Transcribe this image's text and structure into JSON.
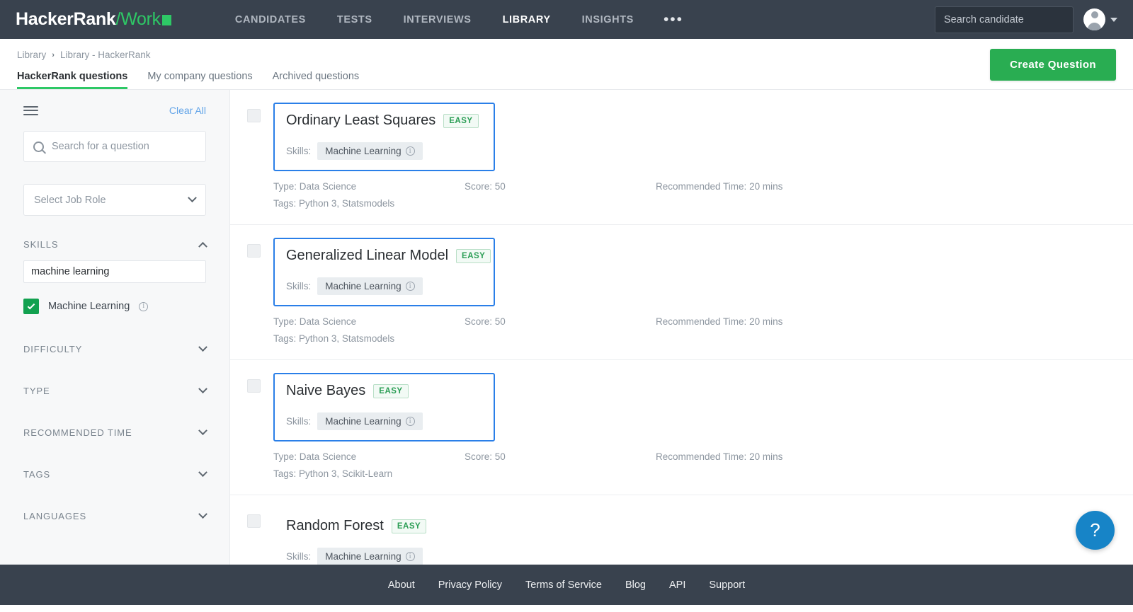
{
  "topnav": {
    "brand_main": "HackerRank",
    "brand_work": "/Work",
    "links": [
      {
        "label": "CANDIDATES",
        "active": false
      },
      {
        "label": "TESTS",
        "active": false
      },
      {
        "label": "INTERVIEWS",
        "active": false
      },
      {
        "label": "LIBRARY",
        "active": true
      },
      {
        "label": "INSIGHTS",
        "active": false
      }
    ],
    "more_dots": "•••",
    "search_placeholder": "Search candidate",
    "search_value": ""
  },
  "subheader": {
    "breadcrumb": [
      "Library",
      "Library - HackerRank"
    ],
    "breadcrumb_sep": "›",
    "tabs": [
      {
        "label": "HackerRank questions",
        "active": true
      },
      {
        "label": "My company questions",
        "active": false
      },
      {
        "label": "Archived questions",
        "active": false
      }
    ],
    "create_button": "Create Question"
  },
  "sidebar": {
    "clear_all": "Clear All",
    "search_placeholder": "Search for a question",
    "search_value": "",
    "job_role_label": "Select Job Role",
    "skills_section": {
      "title": "SKILLS",
      "input_value": "machine learning",
      "options": [
        {
          "label": "Machine Learning",
          "checked": true
        }
      ]
    },
    "collapsed_sections": [
      {
        "title": "DIFFICULTY"
      },
      {
        "title": "TYPE"
      },
      {
        "title": "RECOMMENDED TIME"
      },
      {
        "title": "TAGS"
      },
      {
        "title": "LANGUAGES"
      }
    ]
  },
  "questions": {
    "labels": {
      "skills": "Skills:",
      "type": "Type:",
      "score": "Score:",
      "tags": "Tags:",
      "recommended_time": "Recommended Time:"
    },
    "items": [
      {
        "title": "Ordinary Least Squares",
        "difficulty": "EASY",
        "skill": "Machine Learning",
        "type": "Data Science",
        "score": "50",
        "tags": "Python 3, Statsmodels",
        "time": "20 mins",
        "highlighted": true,
        "selected": false
      },
      {
        "title": "Generalized Linear Model",
        "difficulty": "EASY",
        "skill": "Machine Learning",
        "type": "Data Science",
        "score": "50",
        "tags": "Python 3, Statsmodels",
        "time": "20 mins",
        "highlighted": true,
        "selected": false
      },
      {
        "title": "Naive Bayes",
        "difficulty": "EASY",
        "skill": "Machine Learning",
        "type": "Data Science",
        "score": "50",
        "tags": "Python 3, Scikit-Learn",
        "time": "20 mins",
        "highlighted": true,
        "selected": false
      },
      {
        "title": "Random Forest",
        "difficulty": "EASY",
        "skill": "Machine Learning",
        "type": "",
        "score": "",
        "tags": "",
        "time": "",
        "highlighted": false,
        "selected": false
      }
    ]
  },
  "help_button": "?",
  "footer": {
    "links": [
      "About",
      "Privacy Policy",
      "Terms of Service",
      "Blog",
      "API",
      "Support"
    ]
  },
  "colors": {
    "nav_bg": "#39424e",
    "brand_green": "#2ec866",
    "create_green": "#29ad52",
    "highlight_blue": "#2a7fe8",
    "help_blue": "#1784c7",
    "checkbox_green": "#12a150"
  }
}
